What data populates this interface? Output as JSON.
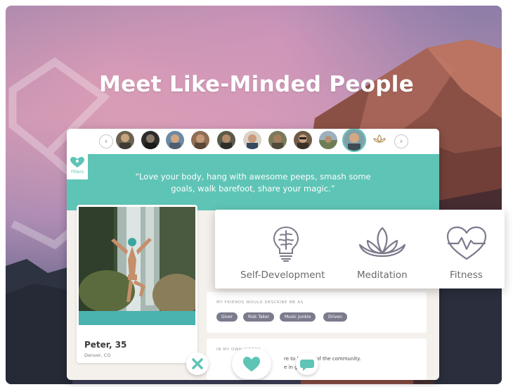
{
  "hero": {
    "title": "Meet Like-Minded People"
  },
  "filters": {
    "label": "Filters"
  },
  "quote": "“Love your body, hang with awesome peeps, smash some goals, walk barefoot, share your magic.”",
  "profile": {
    "name": "Peter, 35",
    "location": "Denver, CO"
  },
  "friends": {
    "title": "MY FRIENDS WOULD DESCRIBE ME AS",
    "tags": [
      "Giver",
      "Risk Taker",
      "Music Junkie",
      "Driven"
    ]
  },
  "own_words": {
    "title": "IN MY OWN WORDS",
    "line1": "re to be part of the community.",
    "line2": "e in general."
  },
  "interests": [
    "Self-Development",
    "Meditation",
    "Fitness"
  ],
  "colors": {
    "accent": "#5ec4b6",
    "tag": "#7b7b8e",
    "icon": "#7d7a8c"
  },
  "icons": {
    "prev": "chevron-left-icon",
    "next": "chevron-right-icon",
    "reject": "close-icon",
    "like": "heart-icon",
    "chat": "chat-bubble-icon"
  }
}
